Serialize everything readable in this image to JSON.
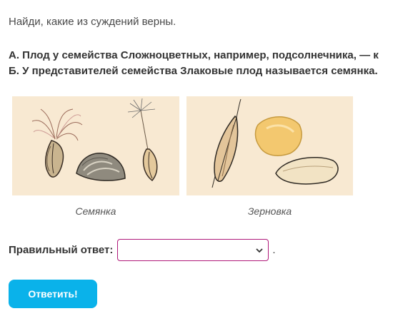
{
  "task": {
    "instruction": "Найди, какие из суждений верны.",
    "statement_a": "А. Плод у семейства Сложноцветных, например, подсолнечника, — к",
    "statement_b": "Б. У представителей семейства Злаковые плод называется семянка."
  },
  "figures": [
    {
      "caption": "Семянка",
      "image": "achene-illustration"
    },
    {
      "caption": "Зерновка",
      "image": "caryopsis-illustration"
    }
  ],
  "answer": {
    "label": "Правильный ответ:",
    "selected_value": "",
    "trailing": ".",
    "icon": "chevron-down-icon",
    "border_color": "#b0197a"
  },
  "submit": {
    "label": "Ответить!",
    "color": "#0ab2ea"
  },
  "colors": {
    "image_background": "#f8e9d2"
  }
}
